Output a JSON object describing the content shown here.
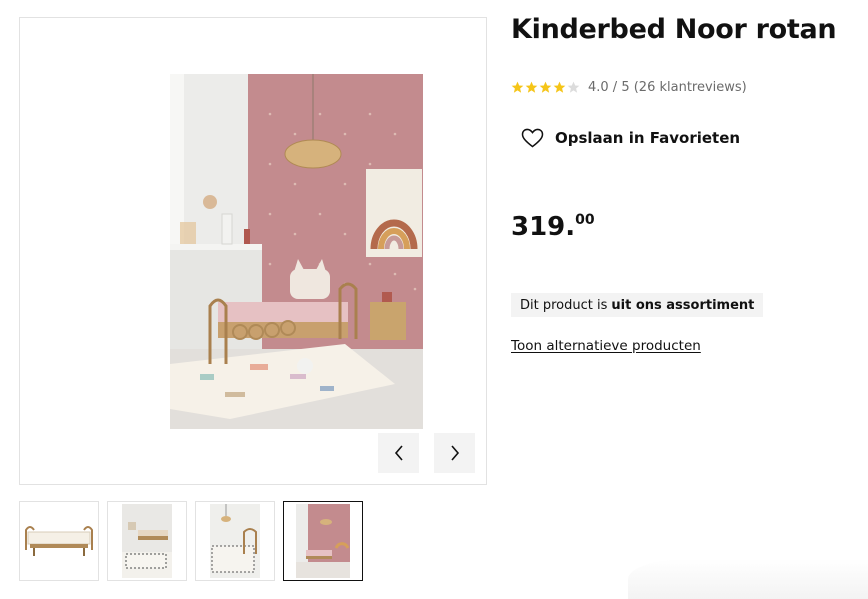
{
  "product": {
    "title": "Kinderbed Noor rotan",
    "rating_text": "4.0 / 5 (26 klantreviews)",
    "rating_value": 4.0,
    "rating_max": 5,
    "favorite_label": "Opslaan in Favorieten",
    "price_main": "319.",
    "price_cents": "00",
    "availability_prefix": "Dit product is",
    "availability_strong": "uit ons assortiment",
    "alt_link": "Toon alternatieve producten"
  },
  "gallery": {
    "active_index": 3,
    "thumbnails": [
      "thumbnail-1",
      "thumbnail-2",
      "thumbnail-3",
      "thumbnail-4"
    ]
  },
  "icons": {
    "star": "star-icon",
    "favorite": "heart-icon",
    "prev": "chevron-left-icon",
    "next": "chevron-right-icon"
  },
  "colors": {
    "star_filled": "#f5c518",
    "star_empty": "#dcdcdc",
    "availability_bg": "#f3f3f3"
  }
}
